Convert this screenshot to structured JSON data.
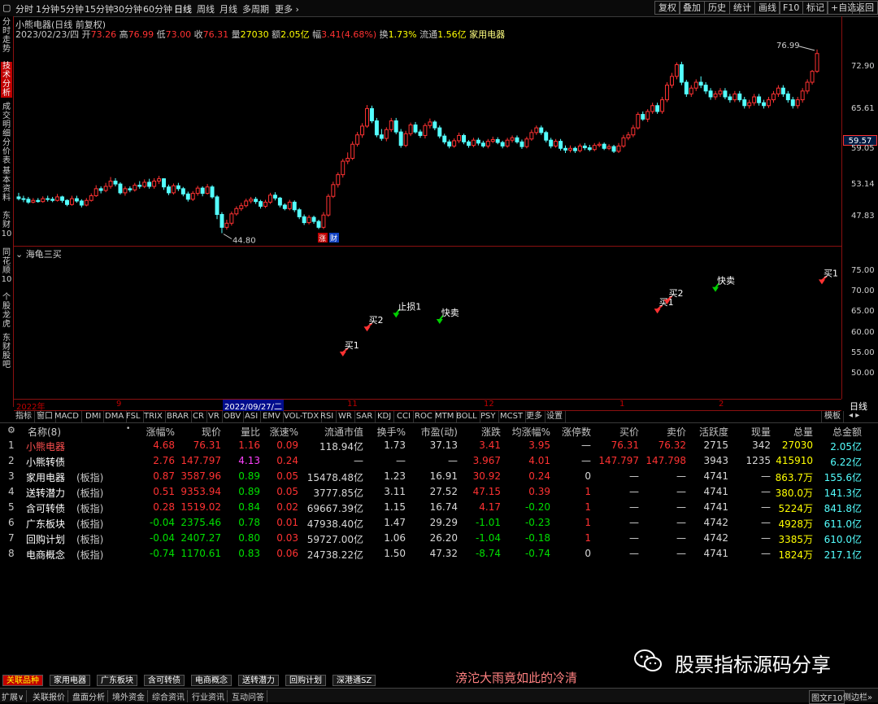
{
  "toolbar": {
    "periods": [
      "分时",
      "1分钟",
      "5分钟",
      "15分钟",
      "30分钟",
      "60分钟",
      "日线",
      "周线",
      "月线",
      "多周期",
      "更多"
    ],
    "active_period": "日线",
    "right_buttons": [
      "复权",
      "叠加",
      "历史",
      "统计",
      "画线",
      "F10",
      "标记",
      "+自选",
      "返回"
    ]
  },
  "left_tabs": [
    "分时走势",
    "技术分析",
    "成交明细",
    "分价表",
    "基本资料",
    "东财10",
    "同花顺10",
    "个股龙虎",
    "东财股吧"
  ],
  "active_left_tab": "技术分析",
  "chart_header": {
    "title": "小熊电器(日线 前复权)",
    "info_date": "2023/02/23/四",
    "open_label": "开",
    "open": "73.26",
    "high_label": "高",
    "high": "76.99",
    "low_label": "低",
    "low": "73.00",
    "close_label": "收",
    "close": "76.31",
    "vol_label": "量",
    "vol": "27030",
    "amt_label": "额",
    "amt": "2.05亿",
    "chg_label": "幅",
    "chg": "3.41(4.68%)",
    "turn_label": "换",
    "turn": "1.73%",
    "float_label": "流通",
    "float": "1.56亿",
    "sector": "家用电器"
  },
  "price_axis": [
    "72.90",
    "65.61",
    "59.05",
    "53.14",
    "47.83"
  ],
  "current_price_tag": "59.57",
  "high_marker": "76.99",
  "low_marker": "44.80",
  "event_tags": [
    "涨",
    "财"
  ],
  "indicator": {
    "name": "海龟三买",
    "axis": [
      "75.00",
      "70.00",
      "65.00",
      "60.00",
      "55.00",
      "50.00"
    ],
    "signals": [
      {
        "label": "买1",
        "color": "#ff4040",
        "x_idx": 67,
        "y": 54.5
      },
      {
        "label": "买2",
        "color": "#ff4040",
        "x_idx": 72,
        "y": 60.5
      },
      {
        "label": "止损1",
        "color": "#40ff40",
        "x_idx": 78,
        "y": 63.8
      },
      {
        "label": "快卖",
        "color": "#40ff40",
        "x_idx": 87,
        "y": 62.3
      },
      {
        "label": "买1",
        "color": "#ff4040",
        "x_idx": 132,
        "y": 64.8
      },
      {
        "label": "买2",
        "color": "#ff4040",
        "x_idx": 134,
        "y": 67.0
      },
      {
        "label": "快卖",
        "color": "#40ff40",
        "x_idx": 144,
        "y": 70.0
      },
      {
        "label": "买1",
        "color": "#ff4040",
        "x_idx": 166,
        "y": 71.8
      }
    ]
  },
  "date_axis": {
    "labels": [
      "2022年",
      "9",
      "2022/09/27/二",
      "11",
      "12",
      "1",
      "2"
    ],
    "right_label": "日线"
  },
  "indicator_tabs": [
    "指标",
    "窗口",
    "MACD",
    "DMI",
    "DMA",
    "FSL",
    "TRIX",
    "BRAR",
    "CR",
    "VR",
    "OBV",
    "ASI",
    "EMV",
    "VOL-TDX",
    "RSI",
    "WR",
    "SAR",
    "KDJ",
    "CCI",
    "ROC",
    "MTM",
    "BOLL",
    "PSY",
    "MCST",
    "更多",
    "设置"
  ],
  "indicator_tabs_right": "模板",
  "table": {
    "headers": [
      "名称(8)",
      "涨幅%",
      "现价",
      "量比",
      "涨速%",
      "流通市值",
      "换手%",
      "市盈(动)",
      "涨跌",
      "均涨幅%",
      "涨停数",
      "买价",
      "卖价",
      "活跃度",
      "现量",
      "总量",
      "总金额"
    ],
    "rows": [
      [
        "1",
        "小熊电器",
        "",
        "4.68",
        "76.31",
        "1.16",
        "0.09",
        "118.94亿",
        "1.73",
        "37.13",
        "3.41",
        "3.95",
        "—",
        "76.31",
        "76.32",
        "2715",
        "342",
        "27030",
        "2.05亿"
      ],
      [
        "2",
        "小熊转债",
        "",
        "2.76",
        "147.797",
        "4.13",
        "0.24",
        "—",
        "—",
        "—",
        "3.967",
        "4.01",
        "—",
        "147.797",
        "147.798",
        "3943",
        "1235",
        "415910",
        "6.22亿"
      ],
      [
        "3",
        "家用电器",
        "(板指)",
        "0.87",
        "3587.96",
        "0.89",
        "0.05",
        "15478.48亿",
        "1.23",
        "16.91",
        "30.92",
        "0.24",
        "0",
        "—",
        "—",
        "4741",
        "—",
        "863.7万",
        "155.6亿"
      ],
      [
        "4",
        "送转潜力",
        "(板指)",
        "0.51",
        "9353.94",
        "0.89",
        "0.05",
        "3777.85亿",
        "3.11",
        "27.52",
        "47.15",
        "0.39",
        "1",
        "—",
        "—",
        "4741",
        "—",
        "380.0万",
        "141.3亿"
      ],
      [
        "5",
        "含可转债",
        "(板指)",
        "0.28",
        "1519.02",
        "0.84",
        "0.02",
        "69667.39亿",
        "1.15",
        "16.74",
        "4.17",
        "-0.20",
        "1",
        "—",
        "—",
        "4741",
        "—",
        "5224万",
        "841.8亿"
      ],
      [
        "6",
        "广东板块",
        "(板指)",
        "-0.04",
        "2375.46",
        "0.78",
        "0.01",
        "47938.40亿",
        "1.47",
        "29.29",
        "-1.01",
        "-0.23",
        "1",
        "—",
        "—",
        "4742",
        "—",
        "4928万",
        "611.0亿"
      ],
      [
        "7",
        "回购计划",
        "(板指)",
        "-0.04",
        "2407.27",
        "0.80",
        "0.03",
        "59727.00亿",
        "1.06",
        "26.20",
        "-1.04",
        "-0.18",
        "1",
        "—",
        "—",
        "4742",
        "—",
        "3385万",
        "610.0亿"
      ],
      [
        "8",
        "电商概念",
        "(板指)",
        "-0.74",
        "1170.61",
        "0.83",
        "0.06",
        "24738.22亿",
        "1.50",
        "47.32",
        "-8.74",
        "-0.74",
        "0",
        "—",
        "—",
        "4741",
        "—",
        "1824万",
        "217.1亿"
      ]
    ]
  },
  "watermark": {
    "text": "股票指标源码分享",
    "poem": "滂沱大雨竟如此的冷清"
  },
  "bottom_tabs": [
    "关联品种",
    "家用电器",
    "广东板块",
    "含可转债",
    "电商概念",
    "送转潜力",
    "回购计划",
    "深港通SZ"
  ],
  "status_items": [
    "扩展∨",
    "关联报价",
    "盘面分析",
    "境外资金",
    "综合资讯",
    "行业资讯",
    "互动问答"
  ],
  "status_right": [
    "图文F10",
    "侧边栏»"
  ],
  "colors": {
    "up": "#ff3232",
    "down": "#54ffff",
    "accent": "#c00000",
    "yellow": "#ffff00",
    "green": "#00e000"
  },
  "chart_data": {
    "type": "candlestick",
    "title": "小熊电器(日线 前复权)",
    "ylim": [
      44.0,
      78.5
    ],
    "candles": [
      [
        51.8,
        51.5,
        52.5,
        51.2
      ],
      [
        51.5,
        51.4,
        52.0,
        50.9
      ],
      [
        51.4,
        50.9,
        51.8,
        50.6
      ],
      [
        50.9,
        51.2,
        51.6,
        50.7
      ],
      [
        51.2,
        51.0,
        51.6,
        50.8
      ],
      [
        51.0,
        51.5,
        51.9,
        50.8
      ],
      [
        51.5,
        51.4,
        52.0,
        51.0
      ],
      [
        51.4,
        51.2,
        51.8,
        50.9
      ],
      [
        51.2,
        51.8,
        52.3,
        51.0
      ],
      [
        51.8,
        51.2,
        52.0,
        50.8
      ],
      [
        51.2,
        50.5,
        51.4,
        50.2
      ],
      [
        50.5,
        51.5,
        52.0,
        50.3
      ],
      [
        51.5,
        51.1,
        52.0,
        50.8
      ],
      [
        51.1,
        50.4,
        51.4,
        50.0
      ],
      [
        50.4,
        51.2,
        51.6,
        50.2
      ],
      [
        51.2,
        52.0,
        52.4,
        51.0
      ],
      [
        52.0,
        53.2,
        53.8,
        51.8
      ],
      [
        53.2,
        52.9,
        53.6,
        52.4
      ],
      [
        52.9,
        53.6,
        54.2,
        52.6
      ],
      [
        53.6,
        54.5,
        55.2,
        53.2
      ],
      [
        54.5,
        54.0,
        55.0,
        53.6
      ],
      [
        54.0,
        52.5,
        54.3,
        52.2
      ],
      [
        52.5,
        53.2,
        53.6,
        52.0
      ],
      [
        53.2,
        53.0,
        53.6,
        52.6
      ],
      [
        53.0,
        53.8,
        54.2,
        52.7
      ],
      [
        53.8,
        53.6,
        54.5,
        53.2
      ],
      [
        53.6,
        54.3,
        54.8,
        53.3
      ],
      [
        54.3,
        53.6,
        54.9,
        53.2
      ],
      [
        53.6,
        54.5,
        55.0,
        53.2
      ],
      [
        54.5,
        54.9,
        55.4,
        54.0
      ],
      [
        54.9,
        53.5,
        55.0,
        53.0
      ],
      [
        53.5,
        52.5,
        53.9,
        52.1
      ],
      [
        52.5,
        53.7,
        54.1,
        52.2
      ],
      [
        53.7,
        53.2,
        54.2,
        52.8
      ],
      [
        53.2,
        52.3,
        53.5,
        51.9
      ],
      [
        52.3,
        51.4,
        52.7,
        51.0
      ],
      [
        51.4,
        52.4,
        52.8,
        51.1
      ],
      [
        52.4,
        53.3,
        53.7,
        52.0
      ],
      [
        53.3,
        52.4,
        53.6,
        51.9
      ],
      [
        52.4,
        53.5,
        54.0,
        52.2
      ],
      [
        53.5,
        51.8,
        53.8,
        51.5
      ],
      [
        51.8,
        48.8,
        52.1,
        48.0
      ],
      [
        48.8,
        46.6,
        49.2,
        45.6
      ],
      [
        46.6,
        47.3,
        47.9,
        46.2
      ],
      [
        47.3,
        48.9,
        49.3,
        46.9
      ],
      [
        48.9,
        49.8,
        50.2,
        48.6
      ],
      [
        49.8,
        50.3,
        50.8,
        49.4
      ],
      [
        50.3,
        51.1,
        51.5,
        50.0
      ],
      [
        51.1,
        51.4,
        51.8,
        50.7
      ],
      [
        51.4,
        51.0,
        51.8,
        50.6
      ],
      [
        51.0,
        50.2,
        51.3,
        49.8
      ],
      [
        50.2,
        50.9,
        51.3,
        49.9
      ],
      [
        50.9,
        52.1,
        52.5,
        50.6
      ],
      [
        52.1,
        51.6,
        52.6,
        51.2
      ],
      [
        51.6,
        50.4,
        51.8,
        50.0
      ],
      [
        50.4,
        49.8,
        50.7,
        49.5
      ],
      [
        49.8,
        50.9,
        51.3,
        49.5
      ],
      [
        50.9,
        49.6,
        51.2,
        49.2
      ],
      [
        49.6,
        48.4,
        49.9,
        48.0
      ],
      [
        48.4,
        47.4,
        48.8,
        47.0
      ],
      [
        47.4,
        48.3,
        48.7,
        47.1
      ],
      [
        48.3,
        47.6,
        48.6,
        47.2
      ],
      [
        47.6,
        46.6,
        47.9,
        46.3
      ],
      [
        46.6,
        48.7,
        49.2,
        46.3
      ],
      [
        48.7,
        51.9,
        52.3,
        48.4
      ],
      [
        51.9,
        53.9,
        54.4,
        51.6
      ],
      [
        53.9,
        55.6,
        56.0,
        53.4
      ],
      [
        55.6,
        57.9,
        58.3,
        55.1
      ],
      [
        57.9,
        58.4,
        59.4,
        57.4
      ],
      [
        58.4,
        60.8,
        61.3,
        58.1
      ],
      [
        60.8,
        62.4,
        62.9,
        60.4
      ],
      [
        62.4,
        63.9,
        64.4,
        61.9
      ],
      [
        63.9,
        66.9,
        67.5,
        63.6
      ],
      [
        66.9,
        64.8,
        67.4,
        64.4
      ],
      [
        64.8,
        62.4,
        65.3,
        62.0
      ],
      [
        62.4,
        61.8,
        63.4,
        61.4
      ],
      [
        61.8,
        63.3,
        63.7,
        61.3
      ],
      [
        63.3,
        64.8,
        65.3,
        62.9
      ],
      [
        64.8,
        62.9,
        65.3,
        62.5
      ],
      [
        62.9,
        60.6,
        63.4,
        60.2
      ],
      [
        60.6,
        62.6,
        63.1,
        60.3
      ],
      [
        62.6,
        64.1,
        64.5,
        62.2
      ],
      [
        64.1,
        62.9,
        64.6,
        62.6
      ],
      [
        62.9,
        62.3,
        63.3,
        61.9
      ],
      [
        62.3,
        64.0,
        64.4,
        61.8
      ],
      [
        64.0,
        64.6,
        65.2,
        63.5
      ],
      [
        64.6,
        63.6,
        64.9,
        63.2
      ],
      [
        63.6,
        62.2,
        64.0,
        61.8
      ],
      [
        62.2,
        61.2,
        62.6,
        60.8
      ],
      [
        61.2,
        60.5,
        61.6,
        60.1
      ],
      [
        60.5,
        61.4,
        61.8,
        60.2
      ],
      [
        61.4,
        62.3,
        62.8,
        61.0
      ],
      [
        62.3,
        61.2,
        62.6,
        60.8
      ],
      [
        61.2,
        60.6,
        61.5,
        60.2
      ],
      [
        60.6,
        61.5,
        61.9,
        60.3
      ],
      [
        61.5,
        61.0,
        61.9,
        60.6
      ],
      [
        61.0,
        60.5,
        61.4,
        60.2
      ],
      [
        60.5,
        61.3,
        61.7,
        60.1
      ],
      [
        61.3,
        61.6,
        62.1,
        61.0
      ],
      [
        61.6,
        61.1,
        62.0,
        60.8
      ],
      [
        61.1,
        60.5,
        61.4,
        60.1
      ],
      [
        60.5,
        61.5,
        61.9,
        60.2
      ],
      [
        61.5,
        61.9,
        62.3,
        61.1
      ],
      [
        61.9,
        61.2,
        62.3,
        60.9
      ],
      [
        61.2,
        60.4,
        61.6,
        60.0
      ],
      [
        60.4,
        61.7,
        62.1,
        60.1
      ],
      [
        61.7,
        62.8,
        63.3,
        61.4
      ],
      [
        62.8,
        63.6,
        64.0,
        62.4
      ],
      [
        63.6,
        62.8,
        64.0,
        62.4
      ],
      [
        62.8,
        61.5,
        63.1,
        61.1
      ],
      [
        61.5,
        60.5,
        61.9,
        60.1
      ],
      [
        60.5,
        61.3,
        61.7,
        60.2
      ],
      [
        61.3,
        60.1,
        61.7,
        59.7
      ],
      [
        60.1,
        59.8,
        60.6,
        59.3
      ],
      [
        59.8,
        60.1,
        60.6,
        59.4
      ],
      [
        60.1,
        59.7,
        60.4,
        59.3
      ],
      [
        59.7,
        60.5,
        60.9,
        59.4
      ],
      [
        60.5,
        60.2,
        61.0,
        59.8
      ],
      [
        60.2,
        59.9,
        60.7,
        59.6
      ],
      [
        59.9,
        60.6,
        61.0,
        59.6
      ],
      [
        60.6,
        60.8,
        61.2,
        60.3
      ],
      [
        60.8,
        60.1,
        61.1,
        59.8
      ],
      [
        60.1,
        60.4,
        60.8,
        59.8
      ],
      [
        60.4,
        59.6,
        60.7,
        59.3
      ],
      [
        59.6,
        60.5,
        61.0,
        59.3
      ],
      [
        60.5,
        61.9,
        62.4,
        60.2
      ],
      [
        61.9,
        62.4,
        62.9,
        61.5
      ],
      [
        62.4,
        63.6,
        64.1,
        62.0
      ],
      [
        63.6,
        65.9,
        66.3,
        63.3
      ],
      [
        65.9,
        65.1,
        66.4,
        64.8
      ],
      [
        65.1,
        66.4,
        66.8,
        64.6
      ],
      [
        66.4,
        67.4,
        67.9,
        66.0
      ],
      [
        67.4,
        66.4,
        67.9,
        66.0
      ],
      [
        66.4,
        68.4,
        68.9,
        66.0
      ],
      [
        68.4,
        70.9,
        71.4,
        68.0
      ],
      [
        70.9,
        72.4,
        73.0,
        70.4
      ],
      [
        72.4,
        74.4,
        74.8,
        71.9
      ],
      [
        74.4,
        71.4,
        74.9,
        70.9
      ],
      [
        71.4,
        69.4,
        71.8,
        68.9
      ],
      [
        69.4,
        70.4,
        70.9,
        68.9
      ],
      [
        70.4,
        71.4,
        71.9,
        69.9
      ],
      [
        71.4,
        70.9,
        72.4,
        70.4
      ],
      [
        70.9,
        69.9,
        71.4,
        69.4
      ],
      [
        69.9,
        68.9,
        70.4,
        68.4
      ],
      [
        68.9,
        69.4,
        69.9,
        68.4
      ],
      [
        69.4,
        69.9,
        70.4,
        68.9
      ],
      [
        69.9,
        68.9,
        70.4,
        68.5
      ],
      [
        68.9,
        68.4,
        69.4,
        67.9
      ],
      [
        68.4,
        69.4,
        69.9,
        68.0
      ],
      [
        69.4,
        68.4,
        69.9,
        68.0
      ],
      [
        68.4,
        67.4,
        68.9,
        66.9
      ],
      [
        67.4,
        67.9,
        68.4,
        66.9
      ],
      [
        67.9,
        68.9,
        69.4,
        67.4
      ],
      [
        68.9,
        67.9,
        69.4,
        67.4
      ],
      [
        67.9,
        67.4,
        68.4,
        66.9
      ],
      [
        67.4,
        68.4,
        68.9,
        67.0
      ],
      [
        68.4,
        69.4,
        69.9,
        67.9
      ],
      [
        69.4,
        70.4,
        70.9,
        68.9
      ],
      [
        70.4,
        69.4,
        70.9,
        68.9
      ],
      [
        69.4,
        68.4,
        69.9,
        67.9
      ],
      [
        68.4,
        67.4,
        68.9,
        66.9
      ],
      [
        67.4,
        68.4,
        68.9,
        66.9
      ],
      [
        68.4,
        69.9,
        70.4,
        67.9
      ],
      [
        69.9,
        71.4,
        71.9,
        69.4
      ],
      [
        71.4,
        73.26,
        73.5,
        71.0
      ],
      [
        73.26,
        76.31,
        76.99,
        73.0
      ]
    ]
  }
}
